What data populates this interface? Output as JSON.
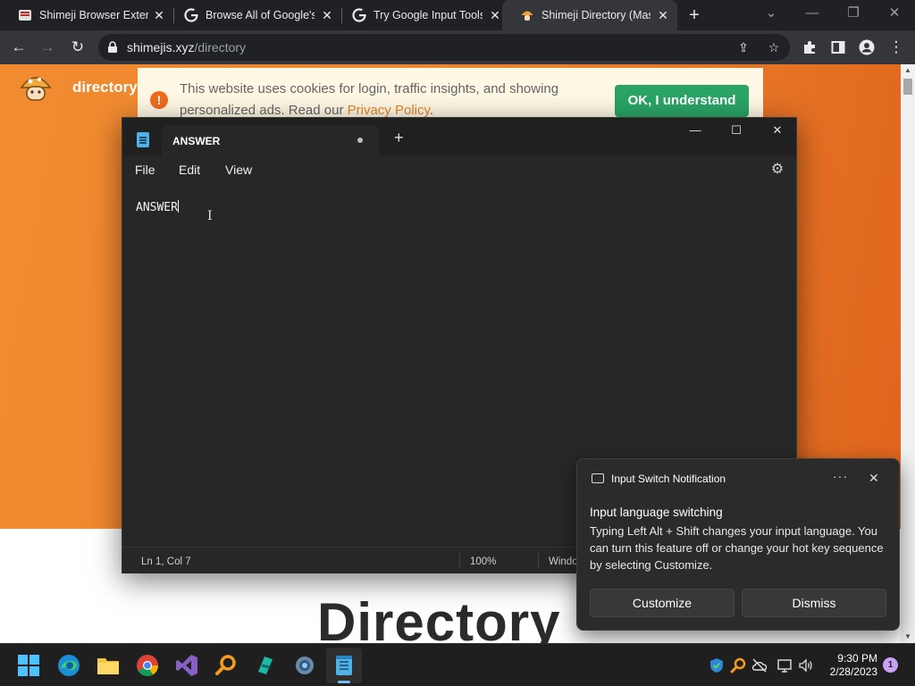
{
  "browser": {
    "tabs": [
      {
        "title": "Shimeji Browser Extens",
        "favicon": "shimeji-favicon"
      },
      {
        "title": "Browse All of Google's",
        "favicon": "google-favicon"
      },
      {
        "title": "Try Google Input Tools",
        "favicon": "google-favicon"
      },
      {
        "title": "Shimeji Directory (Mas",
        "favicon": "shimeji-mushroom-favicon"
      }
    ],
    "active_tab_index": 3,
    "url_host": "shimejis.xyz",
    "url_path": "/directory"
  },
  "page": {
    "site_name": "directory",
    "cookie_text": "This website uses cookies for login, traffic insights, and showing personalized ads. Read our ",
    "cookie_link": "Privacy Policy",
    "cookie_end": ".",
    "cookie_button": "OK, I understand",
    "heading": "Directory"
  },
  "notepad": {
    "tab_title": "ANSWER",
    "menu": [
      "File",
      "Edit",
      "View"
    ],
    "content": "ANSWER",
    "status": {
      "position": "Ln 1, Col 7",
      "zoom": "100%",
      "line_ending": "Windo"
    }
  },
  "notification": {
    "app": "Input Switch Notification",
    "title": "Input language switching",
    "body": "Typing Left Alt + Shift changes your input language. You can turn this feature off or change your hot key sequence by selecting Customize.",
    "buttons": [
      "Customize",
      "Dismiss"
    ]
  },
  "taskbar": {
    "time": "9:30 PM",
    "date": "2/28/2023",
    "notification_count": "1"
  },
  "colors": {
    "hero_orange": "#ee8431",
    "cookie_ok_green": "#2aa566",
    "notepad_bg": "#272727",
    "browser_chrome": "#202124"
  }
}
